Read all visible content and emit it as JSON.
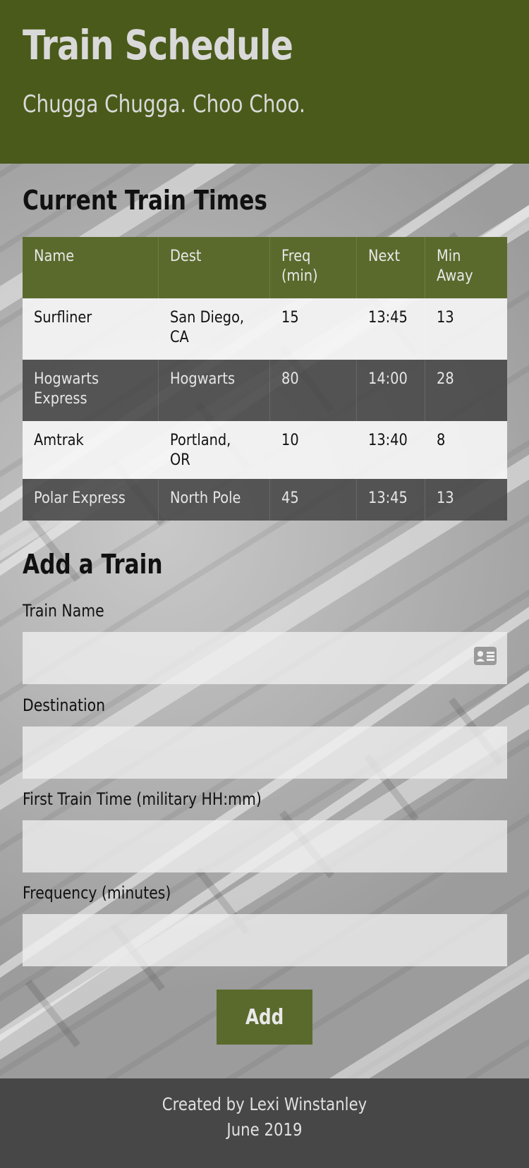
{
  "header": {
    "title": "Train Schedule",
    "subtitle": "Chugga Chugga. Choo Choo."
  },
  "schedule": {
    "title": "Current Train Times",
    "columns": [
      "Name",
      "Dest",
      "Freq (min)",
      "Next",
      "Min Away"
    ],
    "rows": [
      {
        "name": "Surfliner",
        "dest": "San Diego, CA",
        "freq": "15",
        "next": "13:45",
        "away": "13"
      },
      {
        "name": "Hogwarts Express",
        "dest": "Hogwarts",
        "freq": "80",
        "next": "14:00",
        "away": "28"
      },
      {
        "name": "Amtrak",
        "dest": "Portland, OR",
        "freq": "10",
        "next": "13:40",
        "away": "8"
      },
      {
        "name": "Polar Express",
        "dest": "North Pole",
        "freq": "45",
        "next": "13:45",
        "away": "13"
      }
    ]
  },
  "form": {
    "title": "Add a Train",
    "train_name_label": "Train Name",
    "train_name_value": "",
    "destination_label": "Destination",
    "destination_value": "",
    "first_time_label": "First Train Time (military HH:mm)",
    "first_time_value": "",
    "frequency_label": "Frequency (minutes)",
    "frequency_value": "",
    "submit_label": "Add",
    "input_icon": "contact-card-icon"
  },
  "footer": {
    "credit": "Created by Lexi Winstanley",
    "date": "June 2019"
  },
  "colors": {
    "header_bg": "#4a5a1a",
    "accent": "#5a6a2c",
    "footer_bg": "#474747"
  }
}
